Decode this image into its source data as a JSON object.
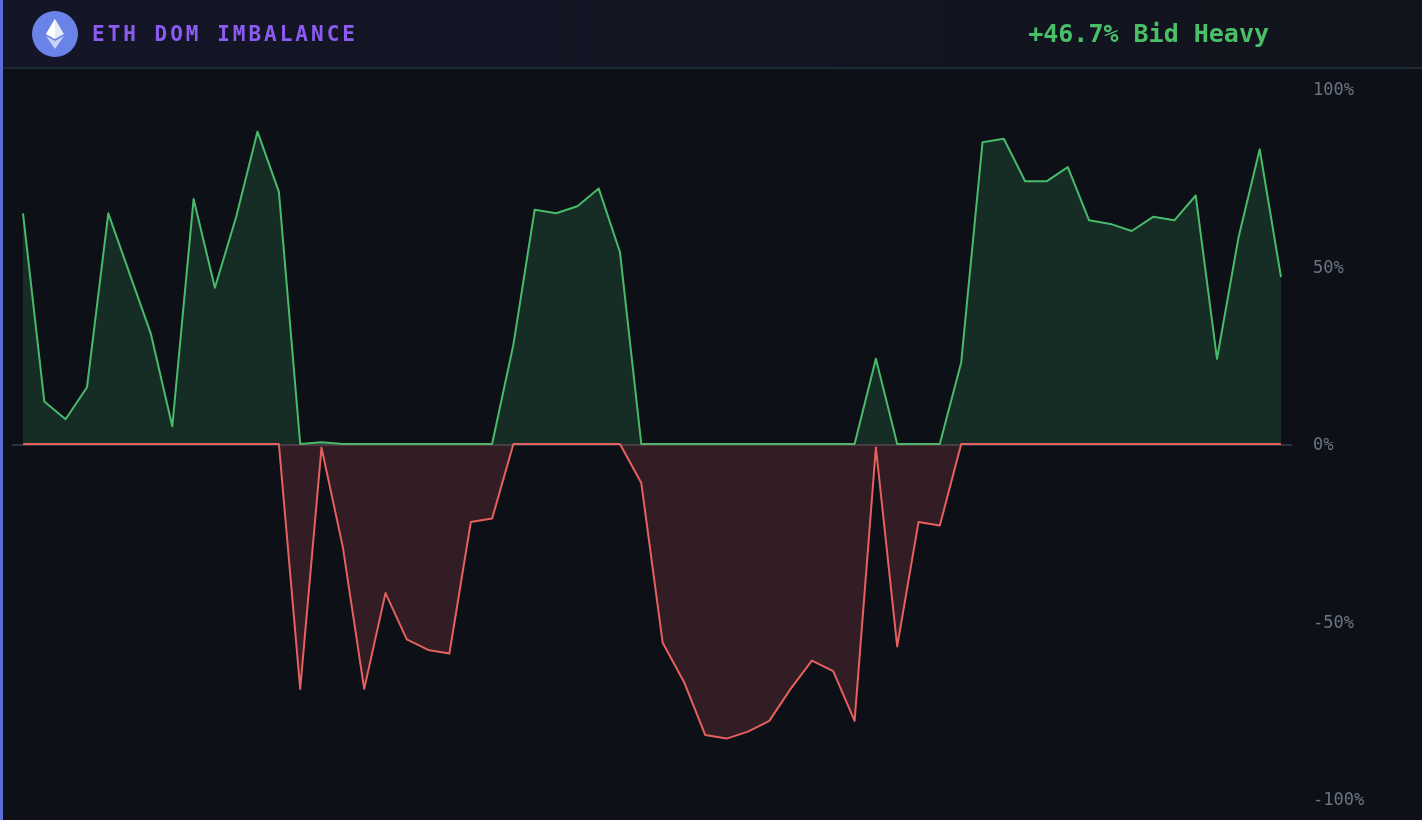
{
  "header": {
    "title": "ETH DOM IMBALANCE",
    "reading": "+46.7% Bid Heavy"
  },
  "chart": {
    "chart_data": {
      "type": "area",
      "ylim": [
        -100,
        100
      ],
      "yticks": [
        {
          "value": 100,
          "label": "100%"
        },
        {
          "value": 50,
          "label": "50%"
        },
        {
          "value": 0,
          "label": "0%"
        },
        {
          "value": -50,
          "label": "-50%"
        },
        {
          "value": -100,
          "label": "-100%"
        }
      ],
      "series": [
        {
          "color": "#48bb6a",
          "values": [
            65,
            12,
            7,
            16,
            65,
            48,
            31,
            5,
            69,
            44,
            64,
            88,
            71,
            0,
            0.5,
            0,
            0,
            0,
            0,
            0,
            0,
            0,
            0,
            28,
            66,
            65,
            67,
            72,
            54,
            0,
            0,
            0,
            0,
            0,
            0,
            0,
            0,
            0,
            0,
            0,
            24,
            0,
            0,
            0,
            23,
            85,
            86,
            74,
            74,
            78,
            63,
            62,
            60,
            64,
            63,
            70,
            24,
            58,
            83,
            47
          ]
        },
        {
          "color": "#e5605e",
          "values": [
            0,
            0,
            0,
            0,
            0,
            0,
            0,
            0,
            0,
            0,
            0,
            0,
            0,
            -69,
            -1,
            -29,
            -69,
            -42,
            -55,
            -58,
            -59,
            -22,
            -21,
            0,
            0,
            0,
            0,
            0,
            0,
            -11,
            -56,
            -67,
            -82,
            -83,
            -81,
            -78,
            -69,
            -61,
            -64,
            -78,
            -1,
            -57,
            -22,
            -23,
            0,
            0,
            0,
            0,
            0,
            0,
            0,
            0,
            0,
            0,
            0,
            0,
            0,
            0,
            0,
            0
          ]
        }
      ]
    }
  }
}
